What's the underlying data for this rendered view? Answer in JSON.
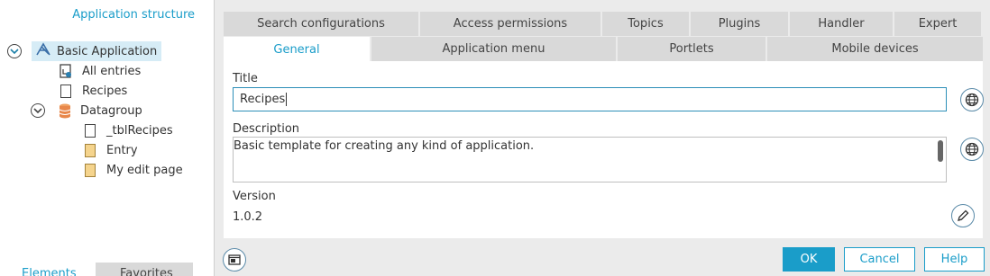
{
  "left": {
    "title": "Application structure",
    "tree": [
      {
        "label": "Basic Application"
      },
      {
        "label": "All entries"
      },
      {
        "label": "Recipes"
      },
      {
        "label": "Datagroup"
      },
      {
        "label": "_tblRecipes"
      },
      {
        "label": "Entry"
      },
      {
        "label": "My edit page"
      }
    ],
    "bottom_tabs": [
      "Elements",
      "Favorites"
    ]
  },
  "tabs_row1": [
    "Search configurations",
    "Access permissions",
    "Topics",
    "Plugins",
    "Handler",
    "Expert"
  ],
  "tabs_row2": [
    "General",
    "Application menu",
    "Portlets",
    "Mobile devices"
  ],
  "form": {
    "title_label": "Title",
    "title_value": "Recipes",
    "description_label": "Description",
    "description_value": "Basic template for creating any kind of application.",
    "version_label": "Version",
    "version_value": "1.0.2"
  },
  "buttons": {
    "ok": "OK",
    "cancel": "Cancel",
    "help": "Help"
  },
  "colors": {
    "accent": "#1a9dc9",
    "tab_inactive": "#d9d9d9",
    "tab_active": "#ffffff",
    "dialog_bg": "#ebebeb",
    "selection": "#d6ecf6"
  }
}
